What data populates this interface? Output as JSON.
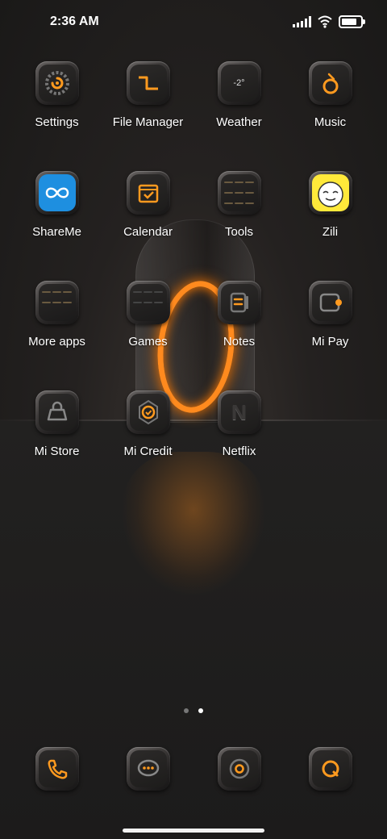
{
  "status": {
    "time": "2:36 AM"
  },
  "rows": [
    [
      {
        "name": "app-settings",
        "icon": "settings-icon",
        "label": "Settings"
      },
      {
        "name": "app-file-manager",
        "icon": "file-manager-icon",
        "label": "File Manager"
      },
      {
        "name": "app-weather",
        "icon": "weather-icon",
        "label": "Weather",
        "icon_text": "-2°"
      },
      {
        "name": "app-music",
        "icon": "music-icon",
        "label": "Music"
      }
    ],
    [
      {
        "name": "app-shareme",
        "icon": "shareme-icon",
        "label": "ShareMe"
      },
      {
        "name": "app-calendar",
        "icon": "calendar-icon",
        "label": "Calendar"
      },
      {
        "name": "folder-tools",
        "icon": "tools-folder-icon",
        "label": "Tools"
      },
      {
        "name": "app-zili",
        "icon": "zili-icon",
        "label": "Zili"
      }
    ],
    [
      {
        "name": "folder-more-apps",
        "icon": "more-apps-folder-icon",
        "label": "More apps"
      },
      {
        "name": "folder-games",
        "icon": "games-folder-icon",
        "label": "Games"
      },
      {
        "name": "app-notes",
        "icon": "notes-icon",
        "label": "Notes"
      },
      {
        "name": "app-mi-pay",
        "icon": "wallet-icon",
        "label": "Mi Pay"
      }
    ],
    [
      {
        "name": "app-mi-store",
        "icon": "shopping-bag-icon",
        "label": "Mi Store"
      },
      {
        "name": "app-mi-credit",
        "icon": "mi-credit-icon",
        "label": "Mi Credit"
      },
      {
        "name": "app-netflix",
        "icon": "netflix-icon",
        "label": "Netflix",
        "icon_text": "N"
      }
    ]
  ],
  "dock": [
    {
      "name": "dock-phone",
      "icon": "phone-icon"
    },
    {
      "name": "dock-messages",
      "icon": "messages-icon"
    },
    {
      "name": "dock-browser",
      "icon": "browser-icon"
    },
    {
      "name": "dock-search",
      "icon": "search-icon"
    }
  ],
  "pager": {
    "pages": 2,
    "current": 2
  },
  "colors": {
    "accent": "#ff9a1f",
    "shareme": "#1e8fe0",
    "zili": "#ffe93a"
  }
}
